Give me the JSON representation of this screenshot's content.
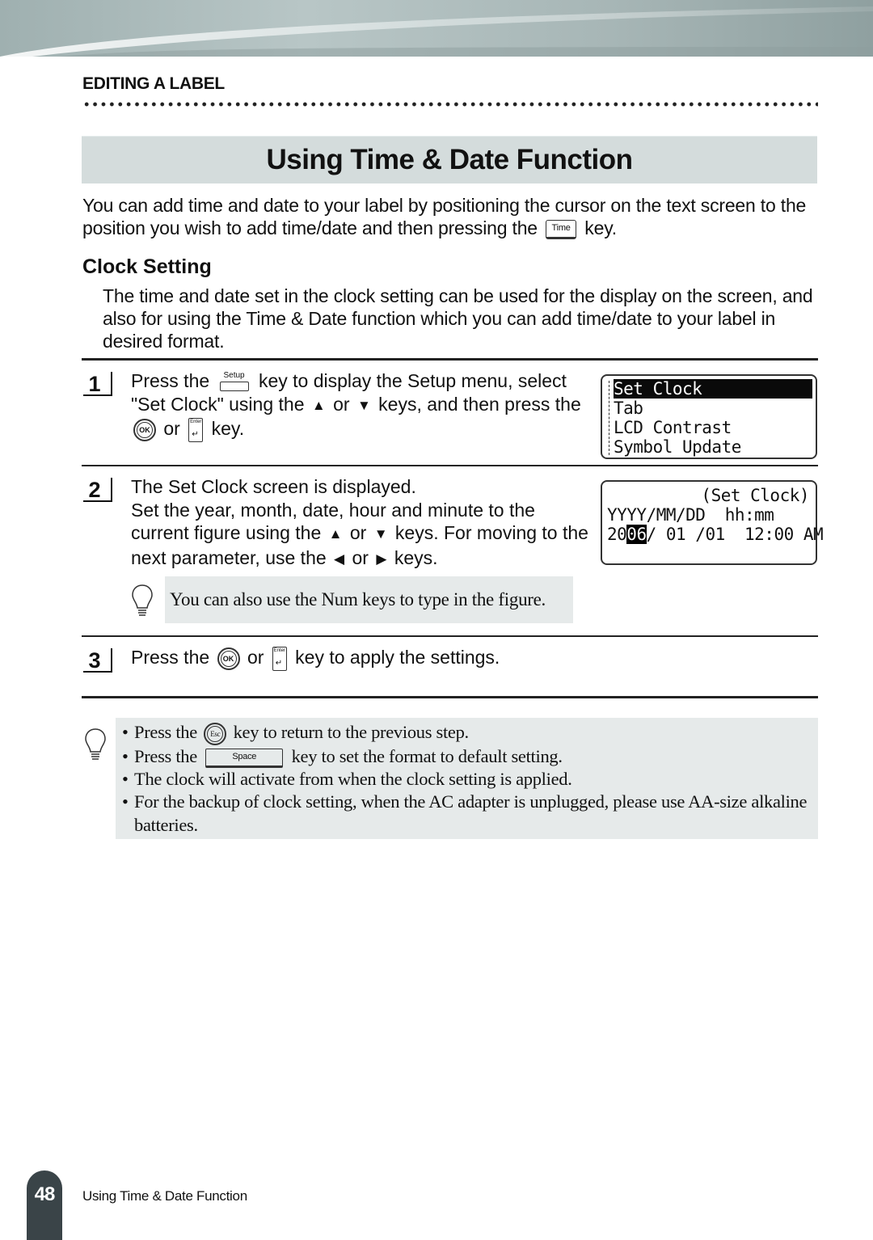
{
  "header": {
    "section_label": "EDITING A LABEL"
  },
  "title": "Using Time & Date Function",
  "intro": {
    "before_key": "You can add time and date to your label by positioning the cursor on the text screen to the position you wish to add time/date and then pressing the",
    "key_label": "Time",
    "after_key": "key."
  },
  "clock_setting": {
    "heading": "Clock Setting",
    "description": "The time and date set in the clock setting can be used for the display on the screen, and also for using the Time & Date function which you can add time/date to your label in desired format."
  },
  "steps": [
    {
      "number": "1",
      "parts": {
        "a": "Press the",
        "setup_key": "Setup",
        "b": "key to display the Setup menu, select \"Set Clock\" using the",
        "or1": "or",
        "c": "keys, and then press the",
        "ok_key": "OK",
        "or2": "or",
        "enter_key": "Enter",
        "d": "key."
      },
      "lcd_menu": {
        "items": [
          "Set Clock",
          "Tab",
          "LCD Contrast",
          "Symbol Update"
        ],
        "selected_index": 0
      }
    },
    {
      "number": "2",
      "line1": "The Set Clock screen is displayed.",
      "parts": {
        "a": "Set the year, month, date, hour and minute to the current figure using the",
        "or1": "or",
        "b": "keys. For moving to the next parameter, use the",
        "or2": "or",
        "c": "keys."
      },
      "tip": "You can also use the Num keys to type in the figure.",
      "lcd_clock": {
        "title": "(Set Clock)",
        "format_line": "YYYY/MM/DD  hh:mm",
        "value_prefix": "20",
        "value_cursor": "06",
        "value_suffix": "/ 01 /01  12:00 AM"
      }
    },
    {
      "number": "3",
      "parts": {
        "a": "Press the",
        "ok_key": "OK",
        "or1": "or",
        "enter_key": "Enter",
        "b": "key to apply the settings."
      }
    }
  ],
  "notes": {
    "items": [
      {
        "a": "Press the",
        "key": "Esc",
        "b": "key to return to the previous step."
      },
      {
        "a": "Press the",
        "key": "Space",
        "b": "key to set the format to default setting."
      },
      {
        "text": "The clock will activate from when the clock setting is applied."
      },
      {
        "text": "For the backup of clock setting, when the AC adapter is unplugged, please use AA-size alkaline batteries."
      }
    ]
  },
  "footer": {
    "page_number": "48",
    "title": "Using Time & Date Function"
  },
  "colors": {
    "title_bar_bg": "#d4dcdc",
    "tip_bg": "#e6eaea",
    "page_tab_bg": "#3a4448"
  }
}
